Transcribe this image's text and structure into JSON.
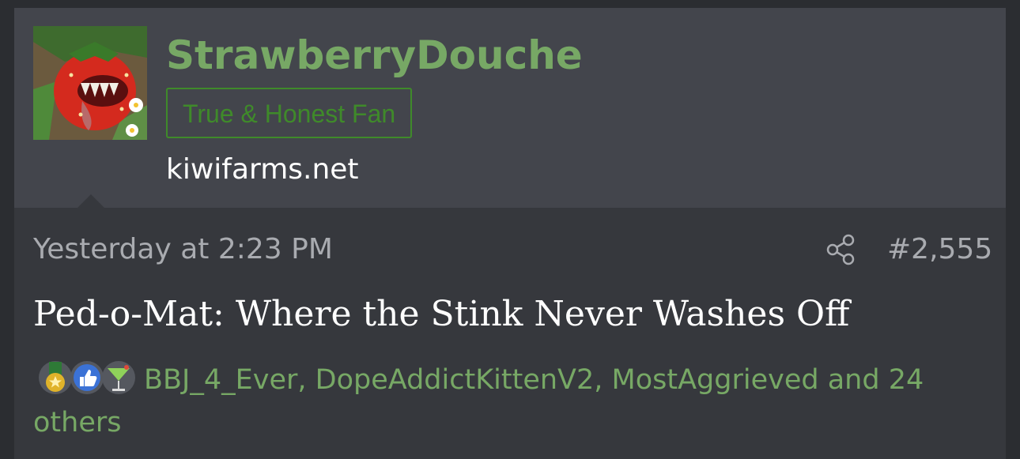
{
  "post": {
    "user": {
      "username": "StrawberryDouche",
      "title": "True & Honest Fan",
      "domain": "kiwifarms.net",
      "avatar_icon": "strawberry-monster-avatar"
    },
    "timestamp": "Yesterday at 2:23 PM",
    "share_icon": "share-icon",
    "number": "#2,555",
    "body": "Ped-o-Mat: Where the Stink Never Washes Off",
    "reactions": {
      "icons": [
        "medal-icon",
        "thumbs-up-icon",
        "cocktail-icon"
      ],
      "users": [
        "BBJ_4_Ever",
        "DopeAddictKittenV2",
        "MostAggrieved"
      ],
      "sep": ", ",
      "and_text": " and ",
      "others_link": "24 others"
    }
  },
  "colors": {
    "accent_green": "#77a865",
    "title_green": "#3f8a2a",
    "userbar_bg": "#43454c",
    "post_bg": "#36383d",
    "meta_text": "#a9abb0"
  }
}
